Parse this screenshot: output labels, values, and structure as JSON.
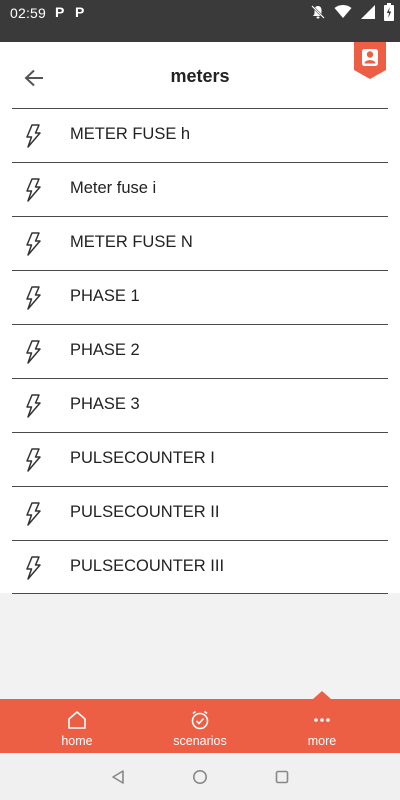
{
  "status_bar": {
    "time": "02:59",
    "notification_icons": [
      "P",
      "P"
    ],
    "system_icons": [
      "notifications-off-icon",
      "wifi-icon",
      "signal-icon",
      "battery-icon"
    ]
  },
  "header": {
    "title": "meters",
    "back_icon": "arrow-left-icon",
    "profile_icon": "user-badge-icon"
  },
  "meters": {
    "item_icon": "lightning-bolt-icon",
    "items": [
      {
        "label": "METER FUSE h"
      },
      {
        "label": "Meter fuse i"
      },
      {
        "label": "METER FUSE N"
      },
      {
        "label": "PHASE 1"
      },
      {
        "label": "PHASE 2"
      },
      {
        "label": "PHASE 3"
      },
      {
        "label": "PULSECOUNTER I"
      },
      {
        "label": "PULSECOUNTER II"
      },
      {
        "label": "PULSECOUNTER III"
      }
    ]
  },
  "bottom_nav": {
    "items": [
      {
        "label": "home",
        "icon": "home-icon"
      },
      {
        "label": "scenarios",
        "icon": "clock-check-icon"
      },
      {
        "label": "more",
        "icon": "more-dots-icon",
        "active": true
      }
    ]
  },
  "system_nav": {
    "buttons": [
      "back-triangle-icon",
      "home-circle-icon",
      "recents-square-icon"
    ]
  },
  "colors": {
    "accent": "#ec5f45",
    "status_bar": "#3a3a3a",
    "text": "#222222",
    "divider": "#4a4a4a"
  }
}
